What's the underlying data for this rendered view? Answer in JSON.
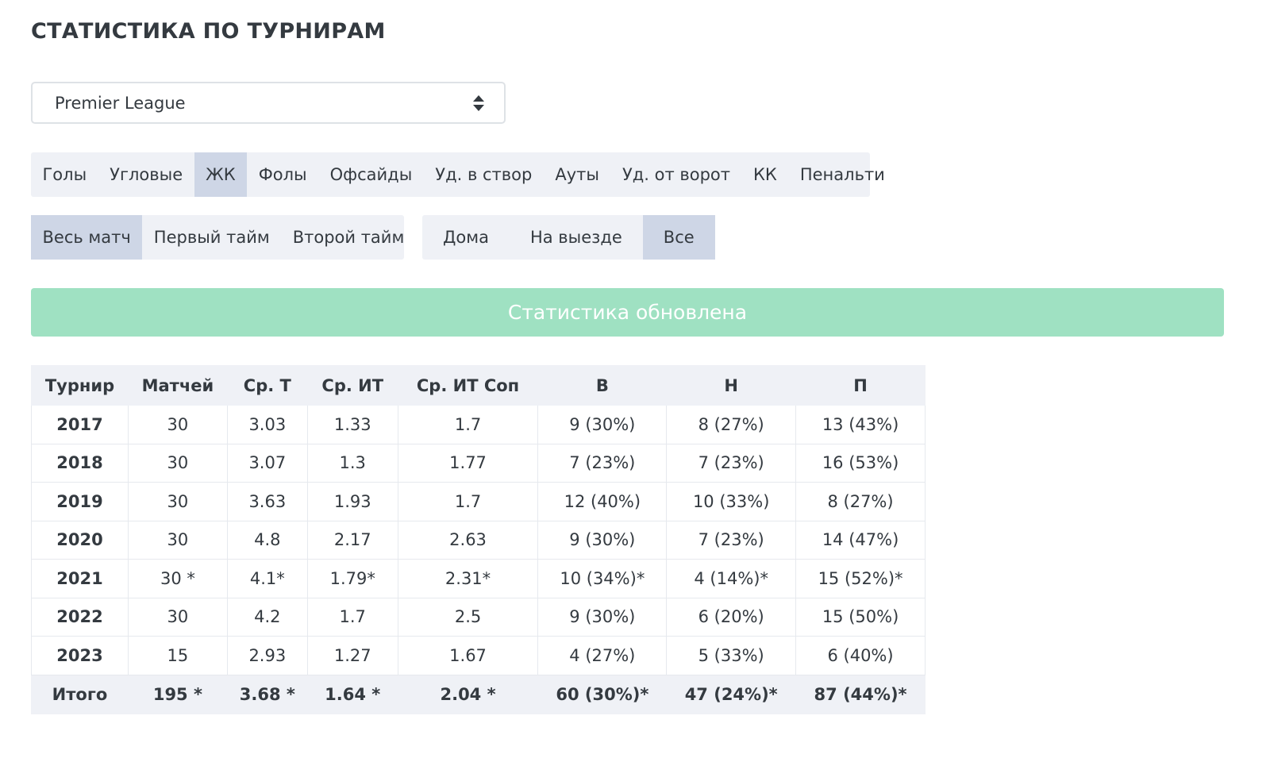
{
  "page_title": "СТАТИСТИКА ПО ТУРНИРАМ",
  "tournament_select": {
    "value": "Premier League"
  },
  "stat_tabs": [
    {
      "label": "Голы",
      "active": false
    },
    {
      "label": "Угловые",
      "active": false
    },
    {
      "label": "ЖК",
      "active": true
    },
    {
      "label": "Фолы",
      "active": false
    },
    {
      "label": "Офсайды",
      "active": false
    },
    {
      "label": "Уд. в створ",
      "active": false
    },
    {
      "label": "Ауты",
      "active": false
    },
    {
      "label": "Уд. от ворот",
      "active": false
    },
    {
      "label": "КК",
      "active": false
    },
    {
      "label": "Пенальти",
      "active": false
    }
  ],
  "period_tabs": [
    {
      "label": "Весь матч",
      "active": true
    },
    {
      "label": "Первый тайм",
      "active": false
    },
    {
      "label": "Второй тайм",
      "active": false
    }
  ],
  "venue_tabs": [
    {
      "label": "Дома",
      "active": false
    },
    {
      "label": "На выезде",
      "active": false
    },
    {
      "label": "Все",
      "active": true
    }
  ],
  "alert": {
    "text": "Статистика обновлена",
    "color": "#9fe1c2"
  },
  "table": {
    "headers": [
      "Турнир",
      "Матчей",
      "Ср. Т",
      "Ср. ИТ",
      "Ср. ИТ Соп",
      "В",
      "Н",
      "П"
    ],
    "rows": [
      [
        "2017",
        "30",
        "3.03",
        "1.33",
        "1.7",
        "9 (30%)",
        "8 (27%)",
        "13 (43%)"
      ],
      [
        "2018",
        "30",
        "3.07",
        "1.3",
        "1.77",
        "7 (23%)",
        "7 (23%)",
        "16 (53%)"
      ],
      [
        "2019",
        "30",
        "3.63",
        "1.93",
        "1.7",
        "12 (40%)",
        "10 (33%)",
        "8 (27%)"
      ],
      [
        "2020",
        "30",
        "4.8",
        "2.17",
        "2.63",
        "9 (30%)",
        "7 (23%)",
        "14 (47%)"
      ],
      [
        "2021",
        "30 *",
        "4.1*",
        "1.79*",
        "2.31*",
        "10 (34%)*",
        "4 (14%)*",
        "15 (52%)*"
      ],
      [
        "2022",
        "30",
        "4.2",
        "1.7",
        "2.5",
        "9 (30%)",
        "6 (20%)",
        "15 (50%)"
      ],
      [
        "2023",
        "15",
        "2.93",
        "1.27",
        "1.67",
        "4 (27%)",
        "5 (33%)",
        "6 (40%)"
      ]
    ],
    "total": [
      "Итого",
      "195 *",
      "3.68 *",
      "1.64 *",
      "2.04 *",
      "60 (30%)*",
      "47 (24%)*",
      "87 (44%)*"
    ]
  }
}
